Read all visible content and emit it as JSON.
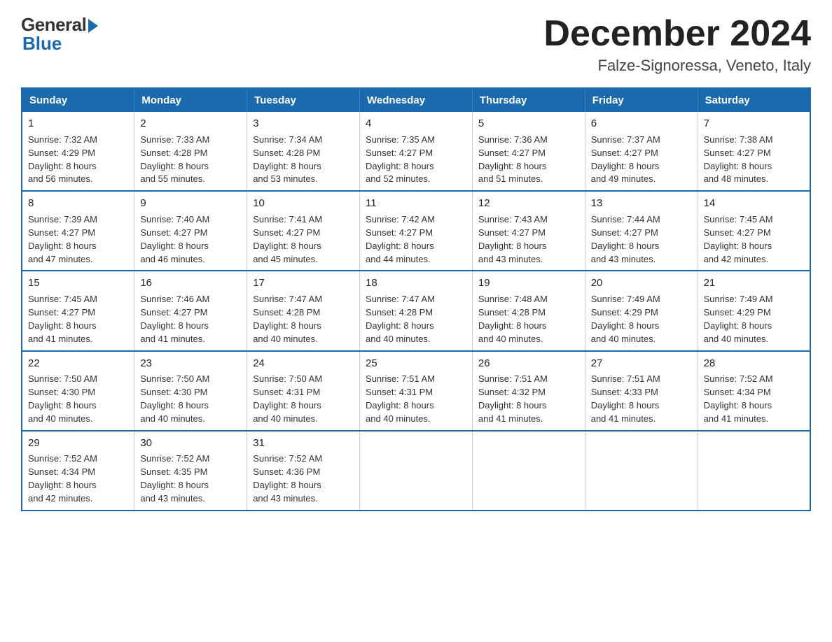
{
  "header": {
    "logo_general": "General",
    "logo_blue": "Blue",
    "title": "December 2024",
    "subtitle": "Falze-Signoressa, Veneto, Italy"
  },
  "weekdays": [
    "Sunday",
    "Monday",
    "Tuesday",
    "Wednesday",
    "Thursday",
    "Friday",
    "Saturday"
  ],
  "weeks": [
    [
      {
        "day": "1",
        "sunrise": "Sunrise: 7:32 AM",
        "sunset": "Sunset: 4:29 PM",
        "daylight": "Daylight: 8 hours",
        "daylight2": "and 56 minutes."
      },
      {
        "day": "2",
        "sunrise": "Sunrise: 7:33 AM",
        "sunset": "Sunset: 4:28 PM",
        "daylight": "Daylight: 8 hours",
        "daylight2": "and 55 minutes."
      },
      {
        "day": "3",
        "sunrise": "Sunrise: 7:34 AM",
        "sunset": "Sunset: 4:28 PM",
        "daylight": "Daylight: 8 hours",
        "daylight2": "and 53 minutes."
      },
      {
        "day": "4",
        "sunrise": "Sunrise: 7:35 AM",
        "sunset": "Sunset: 4:27 PM",
        "daylight": "Daylight: 8 hours",
        "daylight2": "and 52 minutes."
      },
      {
        "day": "5",
        "sunrise": "Sunrise: 7:36 AM",
        "sunset": "Sunset: 4:27 PM",
        "daylight": "Daylight: 8 hours",
        "daylight2": "and 51 minutes."
      },
      {
        "day": "6",
        "sunrise": "Sunrise: 7:37 AM",
        "sunset": "Sunset: 4:27 PM",
        "daylight": "Daylight: 8 hours",
        "daylight2": "and 49 minutes."
      },
      {
        "day": "7",
        "sunrise": "Sunrise: 7:38 AM",
        "sunset": "Sunset: 4:27 PM",
        "daylight": "Daylight: 8 hours",
        "daylight2": "and 48 minutes."
      }
    ],
    [
      {
        "day": "8",
        "sunrise": "Sunrise: 7:39 AM",
        "sunset": "Sunset: 4:27 PM",
        "daylight": "Daylight: 8 hours",
        "daylight2": "and 47 minutes."
      },
      {
        "day": "9",
        "sunrise": "Sunrise: 7:40 AM",
        "sunset": "Sunset: 4:27 PM",
        "daylight": "Daylight: 8 hours",
        "daylight2": "and 46 minutes."
      },
      {
        "day": "10",
        "sunrise": "Sunrise: 7:41 AM",
        "sunset": "Sunset: 4:27 PM",
        "daylight": "Daylight: 8 hours",
        "daylight2": "and 45 minutes."
      },
      {
        "day": "11",
        "sunrise": "Sunrise: 7:42 AM",
        "sunset": "Sunset: 4:27 PM",
        "daylight": "Daylight: 8 hours",
        "daylight2": "and 44 minutes."
      },
      {
        "day": "12",
        "sunrise": "Sunrise: 7:43 AM",
        "sunset": "Sunset: 4:27 PM",
        "daylight": "Daylight: 8 hours",
        "daylight2": "and 43 minutes."
      },
      {
        "day": "13",
        "sunrise": "Sunrise: 7:44 AM",
        "sunset": "Sunset: 4:27 PM",
        "daylight": "Daylight: 8 hours",
        "daylight2": "and 43 minutes."
      },
      {
        "day": "14",
        "sunrise": "Sunrise: 7:45 AM",
        "sunset": "Sunset: 4:27 PM",
        "daylight": "Daylight: 8 hours",
        "daylight2": "and 42 minutes."
      }
    ],
    [
      {
        "day": "15",
        "sunrise": "Sunrise: 7:45 AM",
        "sunset": "Sunset: 4:27 PM",
        "daylight": "Daylight: 8 hours",
        "daylight2": "and 41 minutes."
      },
      {
        "day": "16",
        "sunrise": "Sunrise: 7:46 AM",
        "sunset": "Sunset: 4:27 PM",
        "daylight": "Daylight: 8 hours",
        "daylight2": "and 41 minutes."
      },
      {
        "day": "17",
        "sunrise": "Sunrise: 7:47 AM",
        "sunset": "Sunset: 4:28 PM",
        "daylight": "Daylight: 8 hours",
        "daylight2": "and 40 minutes."
      },
      {
        "day": "18",
        "sunrise": "Sunrise: 7:47 AM",
        "sunset": "Sunset: 4:28 PM",
        "daylight": "Daylight: 8 hours",
        "daylight2": "and 40 minutes."
      },
      {
        "day": "19",
        "sunrise": "Sunrise: 7:48 AM",
        "sunset": "Sunset: 4:28 PM",
        "daylight": "Daylight: 8 hours",
        "daylight2": "and 40 minutes."
      },
      {
        "day": "20",
        "sunrise": "Sunrise: 7:49 AM",
        "sunset": "Sunset: 4:29 PM",
        "daylight": "Daylight: 8 hours",
        "daylight2": "and 40 minutes."
      },
      {
        "day": "21",
        "sunrise": "Sunrise: 7:49 AM",
        "sunset": "Sunset: 4:29 PM",
        "daylight": "Daylight: 8 hours",
        "daylight2": "and 40 minutes."
      }
    ],
    [
      {
        "day": "22",
        "sunrise": "Sunrise: 7:50 AM",
        "sunset": "Sunset: 4:30 PM",
        "daylight": "Daylight: 8 hours",
        "daylight2": "and 40 minutes."
      },
      {
        "day": "23",
        "sunrise": "Sunrise: 7:50 AM",
        "sunset": "Sunset: 4:30 PM",
        "daylight": "Daylight: 8 hours",
        "daylight2": "and 40 minutes."
      },
      {
        "day": "24",
        "sunrise": "Sunrise: 7:50 AM",
        "sunset": "Sunset: 4:31 PM",
        "daylight": "Daylight: 8 hours",
        "daylight2": "and 40 minutes."
      },
      {
        "day": "25",
        "sunrise": "Sunrise: 7:51 AM",
        "sunset": "Sunset: 4:31 PM",
        "daylight": "Daylight: 8 hours",
        "daylight2": "and 40 minutes."
      },
      {
        "day": "26",
        "sunrise": "Sunrise: 7:51 AM",
        "sunset": "Sunset: 4:32 PM",
        "daylight": "Daylight: 8 hours",
        "daylight2": "and 41 minutes."
      },
      {
        "day": "27",
        "sunrise": "Sunrise: 7:51 AM",
        "sunset": "Sunset: 4:33 PM",
        "daylight": "Daylight: 8 hours",
        "daylight2": "and 41 minutes."
      },
      {
        "day": "28",
        "sunrise": "Sunrise: 7:52 AM",
        "sunset": "Sunset: 4:34 PM",
        "daylight": "Daylight: 8 hours",
        "daylight2": "and 41 minutes."
      }
    ],
    [
      {
        "day": "29",
        "sunrise": "Sunrise: 7:52 AM",
        "sunset": "Sunset: 4:34 PM",
        "daylight": "Daylight: 8 hours",
        "daylight2": "and 42 minutes."
      },
      {
        "day": "30",
        "sunrise": "Sunrise: 7:52 AM",
        "sunset": "Sunset: 4:35 PM",
        "daylight": "Daylight: 8 hours",
        "daylight2": "and 43 minutes."
      },
      {
        "day": "31",
        "sunrise": "Sunrise: 7:52 AM",
        "sunset": "Sunset: 4:36 PM",
        "daylight": "Daylight: 8 hours",
        "daylight2": "and 43 minutes."
      },
      null,
      null,
      null,
      null
    ]
  ]
}
